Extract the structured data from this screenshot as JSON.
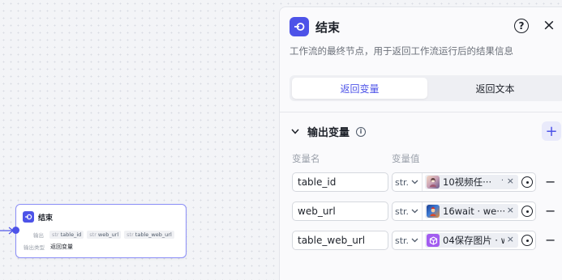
{
  "node": {
    "title": "结束",
    "output_label": "输出",
    "outputs": [
      {
        "type": "str",
        "name": "table_id"
      },
      {
        "type": "str",
        "name": "web_url"
      },
      {
        "type": "str",
        "name": "table_web_url"
      }
    ],
    "type_label": "输出类型",
    "type_value": "返回变量"
  },
  "panel": {
    "title": "结束",
    "help_glyph": "?",
    "close_glyph": "×",
    "description": "工作流的最终节点，用于返回工作流运行后的结果信息",
    "tabs": [
      {
        "label": "返回变量",
        "active": true
      },
      {
        "label": "返回文本",
        "active": false
      }
    ],
    "section_title": "输出变量",
    "add_glyph": "+",
    "col_name": "变量名",
    "col_value": "变量值",
    "variables": [
      {
        "name": "table_id",
        "type": "str.",
        "ref": "10视频任···",
        "ref_suffix": "·",
        "thumb": "avatar-thumbnail"
      },
      {
        "name": "web_url",
        "type": "str.",
        "ref": "16wait · we···",
        "ref_suffix": "",
        "thumb": "game-thumbnail"
      },
      {
        "name": "table_web_url",
        "type": "str.",
        "ref": "04保存图片 · w",
        "ref_suffix": "",
        "thumb": "cube-icon"
      }
    ],
    "remove_glyph": "−"
  },
  "colors": {
    "accent": "#4d53e8",
    "node_border": "#8b8ef7"
  }
}
